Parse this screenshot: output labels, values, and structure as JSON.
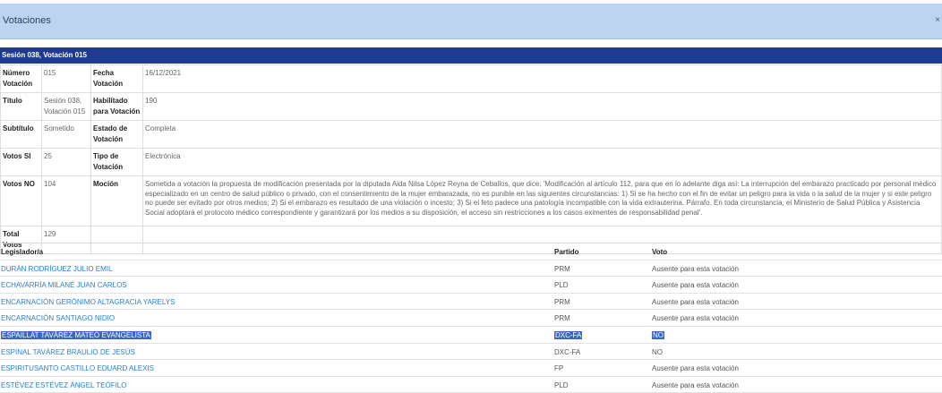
{
  "header": {
    "title": "Votaciones",
    "close_label": "×"
  },
  "session": {
    "title": "Sesión 038, Votación 015"
  },
  "info": {
    "numero_label": "Número Votación",
    "numero_value": "015",
    "fecha_label": "Fecha Votación",
    "fecha_value": "16/12/2021",
    "titulo_label": "Título",
    "titulo_value": "Sesión 038, Votación 015",
    "habilitado_label": "Habilitado para Votación",
    "habilitado_value": "190",
    "subtitulo_label": "Subtítulo",
    "subtitulo_value": "Sometido",
    "estado_label": "Estado de Votación",
    "estado_value": "Completa",
    "votos_si_label": "Votos SI",
    "votos_si_value": "25",
    "tipo_label": "Tipo de Votación",
    "tipo_value": "Electrónica",
    "votos_no_label": "Votos NO",
    "votos_no_value": "104",
    "mocion_label": "Moción",
    "mocion_value": "Sometida a votación la propuesta de modificación presentada por la diputada Aida Nilsa López Reyna de Ceballos, que dice: 'Modificación al artículo 112, para que en lo adelante diga así: La interrupción del embarazo practicado por personal médico especializado en un centro de salud público o privado, con el consentimiento de la mujer embarazada, no es punible en las siguientes circunstancias: 1) Si se ha hecho con el fin de evitar un peligro para la vida o la salud de la mujer y si este peligro no puede ser evitado por otros medios; 2) Si el embarazo es resultado de una violación o incesto; 3) Si el feto padece una patología incompatible con la vida extrauterina. Párrafo. En toda circunstancia, el Ministerio de Salud Pública y Asistencia Social adoptará el protocolo médico correspondiente y garantizará por los medios a su disposición, el acceso sin restricciones a los casos eximentes de responsabilidad penal'.",
    "total_label": "Total Votos",
    "total_value": "129"
  },
  "legislators": {
    "columns": [
      "Legislador/a",
      "Partido",
      "Voto"
    ],
    "rows": [
      {
        "name": "DURÁN RODRÍGUEZ JULIO EMIL",
        "party": "PRM",
        "vote": "Ausente para esta votación"
      },
      {
        "name": "ECHAVARRÍA MILANÉ JUAN CARLOS",
        "party": "PLD",
        "vote": "Ausente para esta votación"
      },
      {
        "name": "ENCARNACIÓN GERÓNIMO ALTAGRACIA YARELYS",
        "party": "PRM",
        "vote": "Ausente para esta votación"
      },
      {
        "name": "ENCARNACIÓN SANTIAGO NIDIO",
        "party": "PRM",
        "vote": "Ausente para esta votación"
      },
      {
        "name": "ESPAILLAT TAVÁREZ MATEO EVANGELISTA",
        "party": "DXC-FA",
        "vote": "NO"
      },
      {
        "name": "ESPINAL TAVÁREZ BRAULIO DE JESÚS",
        "party": "DXC-FA",
        "vote": "NO"
      },
      {
        "name": "ESPIRITUSANTO CASTILLO EDUARD ALEXIS",
        "party": "FP",
        "vote": "Ausente para esta votación"
      },
      {
        "name": "ESTÉVEZ ESTÉVEZ ÁNGEL TEÓFILO",
        "party": "PLD",
        "vote": "Ausente para esta votación"
      }
    ]
  }
}
